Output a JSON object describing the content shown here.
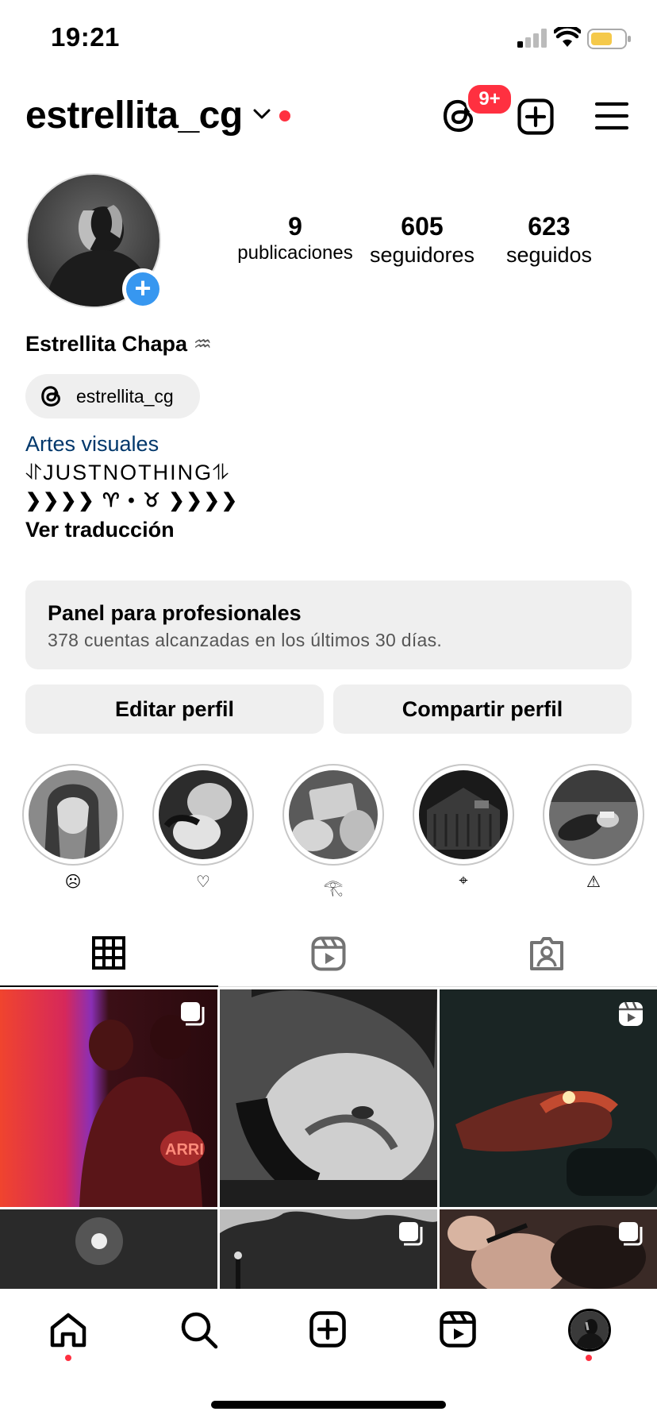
{
  "status_bar": {
    "time": "19:21"
  },
  "header": {
    "username": "estrellita_cg",
    "threads_badge": "9+"
  },
  "profile": {
    "stats": [
      {
        "value": "9",
        "label": "publicaciones"
      },
      {
        "value": "605",
        "label": "seguidores"
      },
      {
        "value": "623",
        "label": "seguidos"
      }
    ],
    "full_name": "Estrellita Chapa",
    "name_symbol": "♒︎",
    "threads_handle": "estrellita_cg",
    "bio": {
      "category": "Artes visuales",
      "line1": "⥯JUSTNOTHING⥮",
      "line2": "❯❯❯❯ ♈︎ • ♉︎ ❯❯❯❯",
      "translate": "Ver traducción"
    }
  },
  "dashboard": {
    "title": "Panel para profesionales",
    "subtitle": "378 cuentas alcanzadas en los últimos 30 días."
  },
  "buttons": {
    "edit": "Editar perfil",
    "share": "Compartir perfil"
  },
  "highlights": [
    {
      "label": "☹"
    },
    {
      "label": "♡"
    },
    {
      "label": "𓂀"
    },
    {
      "label": "⌖"
    },
    {
      "label": "⚠"
    }
  ],
  "colors": {
    "accent": "#3797f0",
    "notification": "#ff3040",
    "link": "#00376b",
    "panel": "#efefef"
  }
}
